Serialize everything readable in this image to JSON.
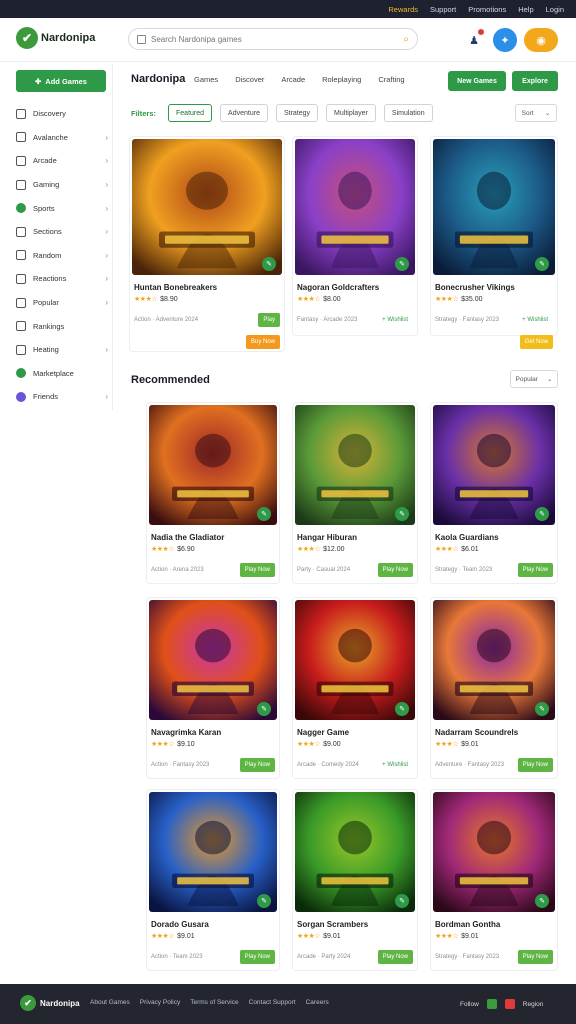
{
  "topbar": {
    "items": [
      "Rewards",
      "Support",
      "Promotions",
      "Help",
      "Login"
    ]
  },
  "header": {
    "logo_text": "Nardonipa",
    "logo_accent": "",
    "search_placeholder": "Search Nardonipa games",
    "coin_label": "◉"
  },
  "sidebar": {
    "button_label": "Add Games",
    "items": [
      {
        "label": "Discovery",
        "icon": "compass-icon",
        "chevron": false
      },
      {
        "label": "Avalanche",
        "icon": "grid-icon",
        "chevron": true
      },
      {
        "label": "Arcade",
        "icon": "gamepad-icon",
        "chevron": true
      },
      {
        "label": "Gaming",
        "icon": "joystick-icon",
        "chevron": true
      },
      {
        "label": "Sports",
        "icon": "ball-icon",
        "chevron": true
      },
      {
        "label": "Sections",
        "icon": "folder-icon",
        "chevron": true
      },
      {
        "label": "Random",
        "icon": "dice-icon",
        "chevron": true
      },
      {
        "label": "Reactions",
        "icon": "heart-icon",
        "chevron": true
      },
      {
        "label": "Popular",
        "icon": "fire-icon",
        "chevron": true
      },
      {
        "label": "Rankings",
        "icon": "trophy-icon",
        "chevron": false
      },
      {
        "label": "Heating",
        "icon": "flame-icon",
        "chevron": true
      },
      {
        "label": "Marketplace",
        "icon": "store-icon",
        "chevron": false
      },
      {
        "label": "Friends",
        "icon": "people-icon",
        "chevron": true
      }
    ]
  },
  "main": {
    "title": "Nardonipa",
    "tabs": [
      "Games",
      "Discover",
      "Arcade",
      "Roleplaying",
      "Crafting"
    ],
    "button_primary": "New Games",
    "button_secondary": "Explore",
    "filter_label": "Filters:",
    "filter_chips": [
      "Featured",
      "Adventure",
      "Strategy",
      "Multiplayer",
      "Simulation"
    ],
    "sort_label": "Sort"
  },
  "featured": [
    {
      "title": "Huntan Bonebreakers",
      "rating_text": "$8.90",
      "meta": "Action · Adventure 2024",
      "button": "Play",
      "button2": "Buy Now",
      "colors": [
        "#f0a020",
        "#b04818",
        "#4a2408"
      ]
    },
    {
      "title": "Nagoran Goldcrafters",
      "rating_text": "$8.00",
      "meta": "Fantasy · Arcade 2023",
      "button": "+ Wishlist",
      "button2": "",
      "colors": [
        "#8a40c8",
        "#c85078",
        "#3a1660"
      ]
    },
    {
      "title": "Bonecrusher Vikings",
      "rating_text": "$35.00",
      "meta": "Strategy · Fantasy 2023",
      "button": "+ Wishlist",
      "button2": "Get Now",
      "colors": [
        "#1c5a88",
        "#28a0b8",
        "#0a1c38"
      ]
    }
  ],
  "section": {
    "title": "Recommended",
    "sort_label": "Popular"
  },
  "games": [
    {
      "title": "Nadia the Gladiator",
      "rating_text": "$6.90",
      "meta": "Action · Arena 2023",
      "button": "Play Now",
      "colors": [
        "#e07020",
        "#a02828",
        "#3a0e10"
      ]
    },
    {
      "title": "Hangar Hiburan",
      "rating_text": "$12.00",
      "meta": "Party · Casual 2024",
      "button": "Play Now",
      "colors": [
        "#5a9a38",
        "#d8b438",
        "#1c3a18"
      ]
    },
    {
      "title": "Kaola Guardians",
      "rating_text": "$6.01",
      "meta": "Strategy · Team 2023",
      "button": "Play Now",
      "colors": [
        "#6a30a8",
        "#d87828",
        "#1a0a3a"
      ]
    },
    {
      "title": "Navagrimka Karan",
      "rating_text": "$9.10",
      "meta": "Action · Fantasy 2023",
      "button": "Play Now",
      "colors": [
        "#e05018",
        "#c838a8",
        "#2a0838"
      ]
    },
    {
      "title": "Nagger Game",
      "rating_text": "$9.00",
      "meta": "Arcade · Comedy 2024",
      "button": "+ Wishlist",
      "colors": [
        "#c81c1c",
        "#e8a828",
        "#3a0808"
      ]
    },
    {
      "title": "Nadarram Scoundrels",
      "rating_text": "$9.01",
      "meta": "Adventure · Fantasy 2023",
      "button": "Play Now",
      "colors": [
        "#e87838",
        "#8a28a8",
        "#2a0a18"
      ]
    },
    {
      "title": "Dorado Gusara",
      "rating_text": "$9.01",
      "meta": "Action · Team 2023",
      "button": "Play Now",
      "colors": [
        "#2860c8",
        "#e89828",
        "#0a1440"
      ]
    },
    {
      "title": "Sorgan Scrambers",
      "rating_text": "$9.01",
      "meta": "Arcade · Party 2024",
      "button": "Play Now",
      "colors": [
        "#3a9a28",
        "#98c828",
        "#0a2a0a"
      ]
    },
    {
      "title": "Bordman Gontha",
      "rating_text": "$9.01",
      "meta": "Strategy · Fantasy 2023",
      "button": "Play Now",
      "colors": [
        "#a02878",
        "#e87828",
        "#2a0818"
      ]
    }
  ],
  "footer": {
    "logo_text": "Nardonipa",
    "links": [
      "About Games",
      "Privacy Policy",
      "Terms of Service",
      "Contact Support",
      "Careers"
    ],
    "right_label": "Follow",
    "right_label2": "Region"
  },
  "colors": {
    "brand_green": "#2e9a48",
    "accent_orange": "#f3a81b",
    "dark": "#1d2130"
  }
}
